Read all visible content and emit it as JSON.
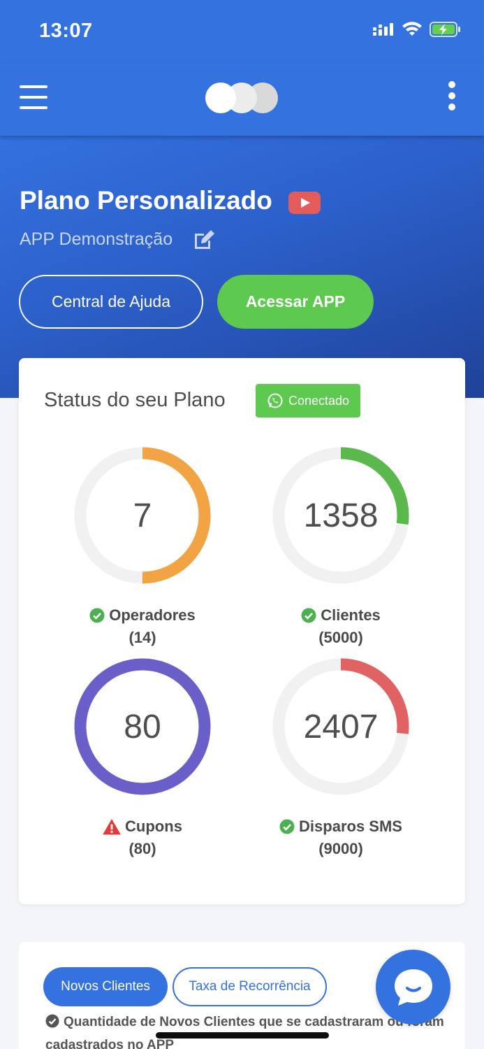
{
  "status_bar": {
    "time": "13:07"
  },
  "hero": {
    "plan_title": "Plano Personalizado",
    "app_name": "APP Demonstração",
    "help_button": "Central de Ajuda",
    "access_button": "Acessar APP"
  },
  "status_card": {
    "title": "Status do seu Plano",
    "badge": "Conectado",
    "gauges": [
      {
        "value": "7",
        "label": "Operadores",
        "limit": "(14)",
        "fraction": 0.5,
        "color": "#f2a444",
        "status": "ok"
      },
      {
        "value": "1358",
        "label": "Clientes",
        "limit": "(5000)",
        "fraction": 0.2716,
        "color": "#5bb84d",
        "status": "ok"
      },
      {
        "value": "80",
        "label": "Cupons",
        "limit": "(80)",
        "fraction": 1.0,
        "color": "#6a5fc8",
        "status": "warning"
      },
      {
        "value": "2407",
        "label": "Disparos SMS",
        "limit": "(9000)",
        "fraction": 0.2674,
        "color": "#e06262",
        "status": "ok"
      }
    ]
  },
  "stats_card": {
    "tabs": [
      "Novos Clientes",
      "Taxa de Recorrência"
    ],
    "description": "Quantidade de Novos Clientes que se cadastraram ou foram cadastrados no APP"
  },
  "colors": {
    "primary": "#3472e0",
    "success": "#5ec94f",
    "track": "#f1f1f1",
    "ok_icon": "#4caf50",
    "warning_icon": "#e03b3b"
  }
}
